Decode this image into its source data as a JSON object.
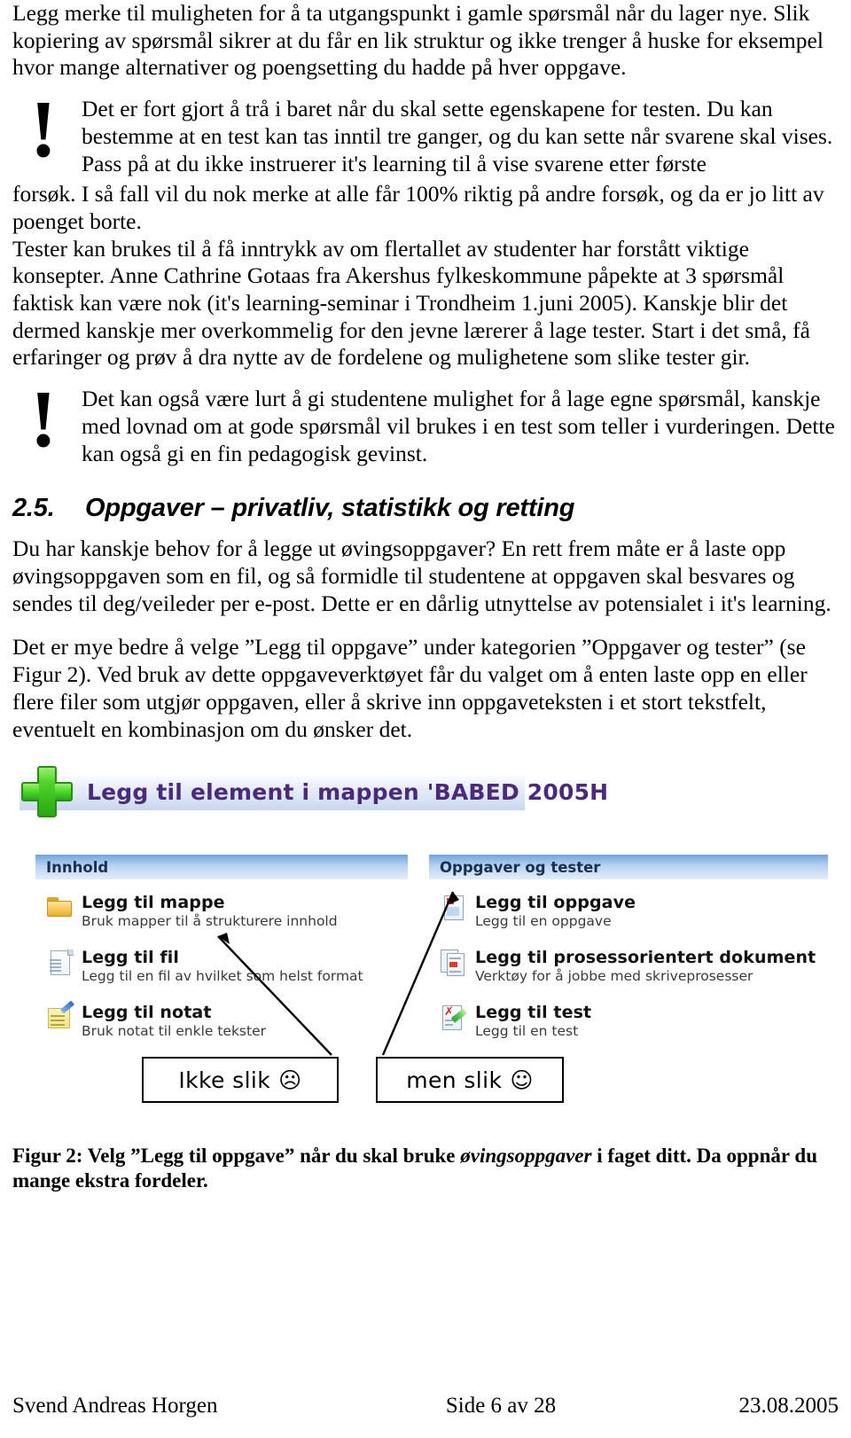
{
  "document": {
    "paragraphs": [
      "Legg merke til muligheten for å ta utgangspunkt i gamle spørsmål når du lager nye. Slik kopiering av spørsmål sikrer at du får en lik struktur og ikke trenger å huske for eksempel hvor mange alternativer og poengsetting du hadde på hver oppgave."
    ],
    "callout_1": {
      "icon": "exclamation-mark",
      "glyph": "!",
      "text": "Det er fort gjort å trå i baret når du skal sette egenskapene for testen. Du kan bestemme at en test kan tas inntil tre ganger, og du kan sette når svarene skal vises. Pass på at du ikke instruerer it's learning til å vise svarene etter første",
      "tail": "forsøk. I så fall vil du nok merke at alle får 100% riktig på andre forsøk, og da er jo litt av poenget borte."
    },
    "paragraph_2": "Tester kan brukes til å få inntrykk av om flertallet av studenter har forstått viktige konsepter. Anne Cathrine Gotaas fra Akershus fylkeskommune påpekte at 3 spørsmål faktisk kan være nok (it's learning-seminar i Trondheim 1.juni 2005). Kanskje blir det dermed kanskje mer overkommelig for den jevne lærerer å lage tester. Start i det små, få erfaringer og prøv å dra nytte av de fordelene og mulighetene som slike tester gir.",
    "callout_2": {
      "icon": "exclamation-mark",
      "glyph": "!",
      "text": "Det kan også være lurt å gi studentene mulighet for å lage egne spørsmål, kanskje med lovnad om at gode spørsmål vil brukes i en test som teller i vurderingen. Dette kan også gi en fin pedagogisk gevinst."
    },
    "heading": {
      "number": "2.5.",
      "title": "Oppgaver – privatliv, statistikk og retting"
    },
    "paragraph_3": "Du har kanskje behov for å legge ut øvingsoppgaver? En rett frem måte er å laste opp øvingsoppgaven som en fil, og så formidle til studentene at oppgaven skal besvares og sendes til deg/veileder per e-post. Dette er en dårlig utnyttelse av potensialet i it's learning.",
    "paragraph_4": "Det er mye bedre å velge ”Legg til oppgave” under kategorien ”Oppgaver og tester” (se Figur 2). Ved bruk av dette oppgaveverktøyet får du valget om å enten laste opp en eller flere filer som utgjør oppgaven, eller å skrive inn oppgaveteksten i et stort tekstfelt, eventuelt en kombinasjon om du ønsker det."
  },
  "figure": {
    "window_title": "Legg til element i mappen 'BABED 2005H",
    "plus_icon": "add-plus-icon",
    "title_color": "#4b2a7b",
    "accent_green": "#34c21b",
    "header_blue": "#6fa3dd",
    "columns": [
      {
        "section_title": "Innhold",
        "items": [
          {
            "icon": "folder-icon",
            "label": "Legg til mappe",
            "sub": "Bruk mapper til å strukturere innhold"
          },
          {
            "icon": "file-icon",
            "label": "Legg til fil",
            "sub": "Legg til en fil av hvilket som helst format"
          },
          {
            "icon": "note-icon",
            "label": "Legg til notat",
            "sub": "Bruk notat til enkle tekster"
          }
        ]
      },
      {
        "section_title": "Oppgaver og tester",
        "items": [
          {
            "icon": "assignment-icon",
            "label": "Legg til oppgave",
            "sub": "Legg til en oppgave"
          },
          {
            "icon": "process-document-icon",
            "label": "Legg til prosessorientert dokument",
            "sub": "Verktøy for å jobbe med skriveprosesser"
          },
          {
            "icon": "test-icon",
            "label": "Legg til test",
            "sub": "Legg til en test"
          }
        ]
      }
    ],
    "annotations": [
      {
        "label": "Ikke slik",
        "face": "☹",
        "face_name": "frowning-face-icon",
        "target": "Legg til fil"
      },
      {
        "label": "men slik",
        "face": "☺",
        "face_name": "smiling-face-icon",
        "target": "Legg til oppgave"
      }
    ],
    "caption": {
      "prefix": "Figur 2: Velg ”Legg til oppgave” når du skal bruke ",
      "italic": "øvingsoppgaver",
      "suffix": " i faget ditt. Da oppnår du mange ekstra fordeler."
    }
  },
  "footer": {
    "author": "Svend Andreas Horgen",
    "page": "Side 6 av 28",
    "date": "23.08.2005"
  }
}
